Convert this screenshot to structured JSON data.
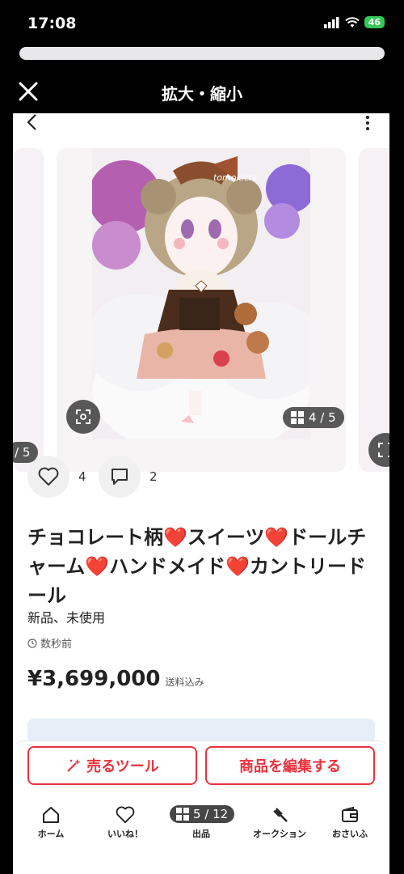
{
  "status_bar": {
    "time": "17:08",
    "battery": "46"
  },
  "zoom_header": {
    "title": "拡大・縮小"
  },
  "gallery": {
    "left_counter": "/ 5",
    "current_counter": "4 / 5",
    "watermark": "tomokichi"
  },
  "actions": {
    "likes": "4",
    "comments": "2"
  },
  "item": {
    "title": "チョコレート柄❤️スイーツ❤️ドールチャーム❤️ハンドメイド❤️カントリードール",
    "condition": "新品、未使用",
    "posted": "数秒前",
    "price": "¥3,699,000",
    "shipping": "送料込み"
  },
  "buttons": {
    "sell_tool": "売るツール",
    "edit": "商品を編集する"
  },
  "nav": {
    "home": "ホーム",
    "likes": "いいね！",
    "sell": "出品",
    "auction": "オークション",
    "wallet": "おさいふ",
    "screenshot_counter": "5 / 12"
  },
  "colors": {
    "accent": "#e8323e",
    "battery": "#34c759"
  }
}
